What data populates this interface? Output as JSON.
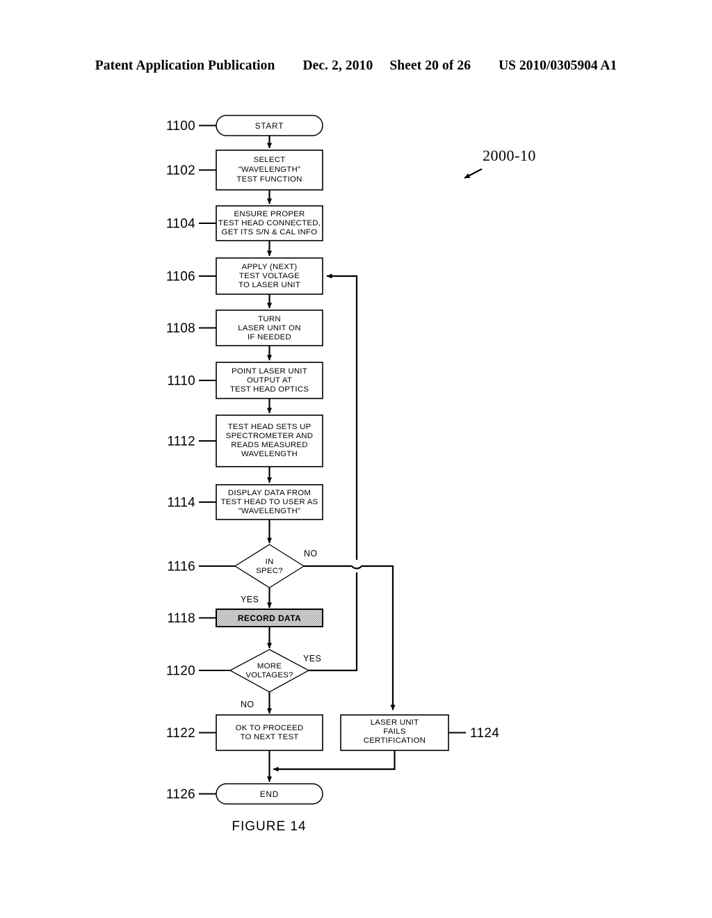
{
  "header": {
    "publication": "Patent Application Publication",
    "date": "Dec. 2, 2010",
    "sheet": "Sheet 20 of 26",
    "patent_number": "US 2010/0305904 A1"
  },
  "figure": {
    "caption": "FIGURE 14",
    "system_label": "2000-10"
  },
  "flowchart": {
    "nodes": [
      {
        "ref": "1100",
        "shape": "terminator",
        "lines": [
          "START"
        ]
      },
      {
        "ref": "1102",
        "shape": "process",
        "lines": [
          "SELECT",
          "\"WAVELENGTH\"",
          "TEST FUNCTION"
        ]
      },
      {
        "ref": "1104",
        "shape": "process",
        "lines": [
          "ENSURE PROPER",
          "TEST HEAD CONNECTED,",
          "GET ITS S/N & CAL INFO"
        ]
      },
      {
        "ref": "1106",
        "shape": "process",
        "lines": [
          "APPLY (NEXT)",
          "TEST VOLTAGE",
          "TO LASER UNIT"
        ]
      },
      {
        "ref": "1108",
        "shape": "process",
        "lines": [
          "TURN",
          "LASER UNIT ON",
          "IF NEEDED"
        ]
      },
      {
        "ref": "1110",
        "shape": "process",
        "lines": [
          "POINT LASER UNIT",
          "OUTPUT AT",
          "TEST HEAD OPTICS"
        ]
      },
      {
        "ref": "1112",
        "shape": "process",
        "lines": [
          "TEST HEAD SETS UP",
          "SPECTROMETER AND",
          "READS MEASURED",
          "WAVELENGTH"
        ]
      },
      {
        "ref": "1114",
        "shape": "process",
        "lines": [
          "DISPLAY DATA FROM",
          "TEST HEAD TO USER AS",
          "\"WAVELENGTH\""
        ]
      },
      {
        "ref": "1116",
        "shape": "decision",
        "lines": [
          "IN",
          "SPEC?"
        ]
      },
      {
        "ref": "1118",
        "shape": "process-highlight",
        "lines": [
          "RECORD DATA"
        ]
      },
      {
        "ref": "1120",
        "shape": "decision",
        "lines": [
          "MORE",
          "VOLTAGES?"
        ]
      },
      {
        "ref": "1122",
        "shape": "process",
        "lines": [
          "OK TO PROCEED",
          "TO NEXT TEST"
        ]
      },
      {
        "ref": "1124",
        "shape": "process",
        "lines": [
          "LASER UNIT",
          "FAILS",
          "CERTIFICATION"
        ]
      },
      {
        "ref": "1126",
        "shape": "terminator",
        "lines": [
          "END"
        ]
      }
    ],
    "branch_labels": {
      "in_spec_no": "NO",
      "in_spec_yes": "YES",
      "more_voltages_yes": "YES",
      "more_voltages_no": "NO"
    }
  }
}
